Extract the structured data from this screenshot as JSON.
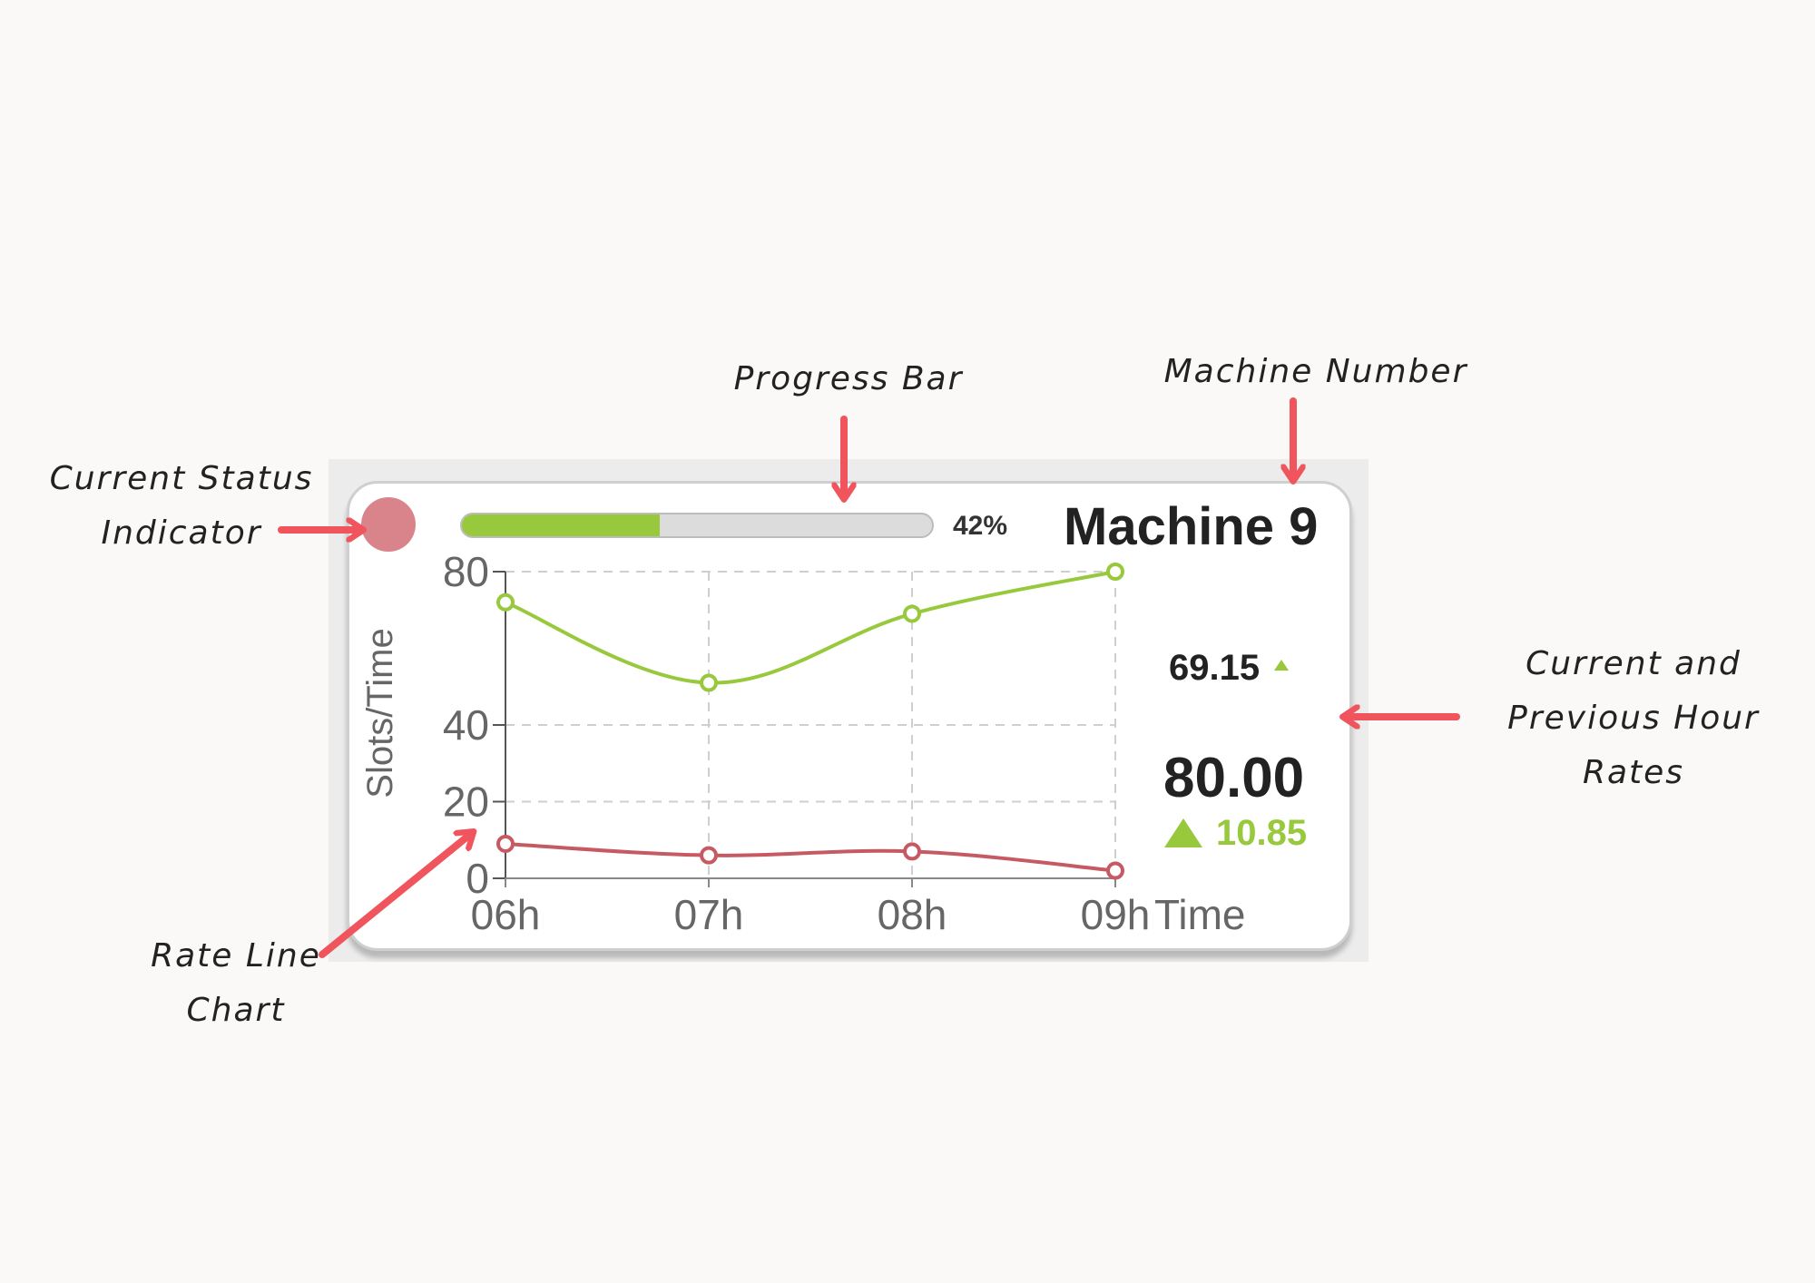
{
  "annotations": {
    "status": [
      "Current Status",
      "Indicator"
    ],
    "progress": [
      "Progress Bar"
    ],
    "machine": [
      "Machine Number"
    ],
    "rates": [
      "Current and",
      "Previous Hour",
      "Rates"
    ],
    "chart": [
      "Rate Line",
      "Chart"
    ]
  },
  "card": {
    "status_color": "#d9848a",
    "progress_percent": 42,
    "progress_label": "42%",
    "title": "Machine 9",
    "previous_rate": "69.15",
    "current_rate": "80.00",
    "delta": "10.85"
  },
  "colors": {
    "green": "#98c93c",
    "red": "#c65a63",
    "arrow": "#f0545c"
  },
  "chart_data": {
    "type": "line",
    "x": [
      "06h",
      "07h",
      "08h",
      "09h"
    ],
    "series": [
      {
        "values": [
          72,
          51,
          69,
          80
        ],
        "color": "#98c93c"
      },
      {
        "values": [
          9,
          6,
          7,
          2
        ],
        "color": "#c65a63"
      }
    ],
    "ylabel": "Slots/Time",
    "xlabel": "Time",
    "yticks": [
      0,
      20,
      40,
      80
    ],
    "ylim": [
      0,
      80
    ],
    "grid": true
  }
}
